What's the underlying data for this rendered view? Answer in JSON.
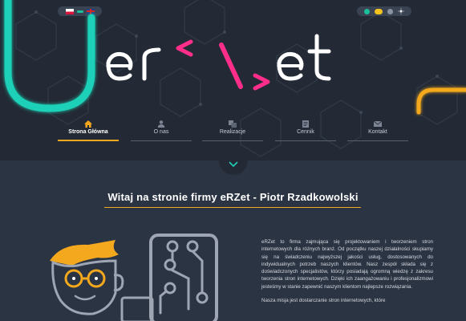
{
  "languages": [
    {
      "code": "pl",
      "name": "Polski"
    },
    {
      "code": "en",
      "name": "English"
    }
  ],
  "theme": {
    "colors": [
      "#1bbf9a",
      "#f4c21d",
      "#8a93a3"
    ]
  },
  "logo": {
    "text": "erzet",
    "colors": {
      "u": "#1fd1b7",
      "main": "#ffffff",
      "arrows": "#ff2e8a",
      "accent": "#f4a81d"
    }
  },
  "nav": {
    "items": [
      {
        "label": "Strona Główna",
        "icon": "home-icon",
        "active": true
      },
      {
        "label": "O nas",
        "icon": "person-icon",
        "active": false
      },
      {
        "label": "Realizacje",
        "icon": "portfolio-icon",
        "active": false
      },
      {
        "label": "Cennik",
        "icon": "pricelist-icon",
        "active": false
      },
      {
        "label": "Kontakt",
        "icon": "mail-icon",
        "active": false
      }
    ]
  },
  "main": {
    "heading": "Witaj na stronie firmy eRZet - Piotr Rzadkowolski",
    "paragraphs": [
      "eRZet to firma zajmująca się projektowaniem i tworzeniem stron internetowych dla różnych branż. Od początku naszej działalności skupiamy się na świadczeniu najwyższej jakości usług, dostosowanych do indywidualnych potrzeb naszych klientów. Nasz zespół składa się z doświadczonych specjalistów, którzy posiadają ogromną wiedzę z zakresu tworzenia stron internetowych. Dzięki ich zaangażowaniu i profesjonalizmowi jesteśmy w stanie zapewnić naszym klientom najlepsze rozwiązania.",
      "Nasza misja jest dostarczanie stron internetowych, które"
    ]
  },
  "colors": {
    "accent": "#f4a81d",
    "hero_bg": "#232a35",
    "page_bg": "#2b3443"
  }
}
